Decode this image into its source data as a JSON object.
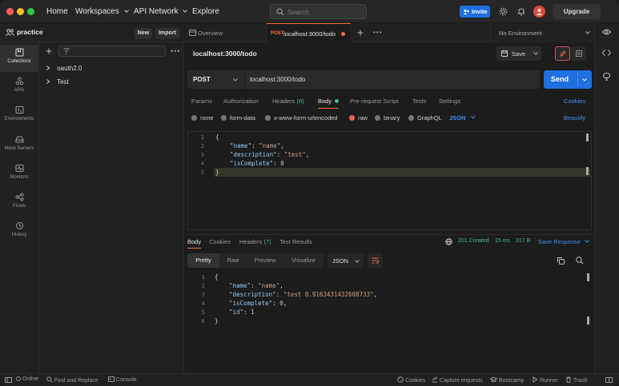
{
  "titlebar": {
    "nav": [
      "Home",
      "Workspaces",
      "API Network",
      "Explore"
    ],
    "search_placeholder": "Search",
    "invite_label": "Invite",
    "upgrade_label": "Upgrade"
  },
  "workspace": {
    "name": "practice",
    "new_label": "New",
    "import_label": "Import"
  },
  "rail": [
    {
      "label": "Collections",
      "icon": "collections-icon"
    },
    {
      "label": "APIs",
      "icon": "apis-icon"
    },
    {
      "label": "Environments",
      "icon": "environments-icon"
    },
    {
      "label": "Mock Servers",
      "icon": "mock-servers-icon"
    },
    {
      "label": "Monitors",
      "icon": "monitors-icon"
    },
    {
      "label": "Flows",
      "icon": "flows-icon"
    },
    {
      "label": "History",
      "icon": "history-icon"
    }
  ],
  "collections": [
    "oauth2.0",
    "Test"
  ],
  "tabs": {
    "overview": "Overview",
    "active_method": "POST",
    "active_title": "localhost:3000/todo",
    "environment": "No Environment"
  },
  "request": {
    "title": "localhost:3000/todo",
    "save_label": "Save",
    "method": "POST",
    "url": "localhost:3000/todo",
    "send_label": "Send",
    "subtabs": [
      "Params",
      "Authorization",
      "Headers",
      "Body",
      "Pre-request Script",
      "Tests",
      "Settings"
    ],
    "headers_count": "(8)",
    "cookies_label": "Cookies",
    "body_types": [
      "none",
      "form-data",
      "x-www-form-urlencoded",
      "raw",
      "binary",
      "GraphQL"
    ],
    "body_format": "JSON",
    "beautify_label": "Beautify",
    "line_numbers": [
      "1",
      "2",
      "3",
      "4",
      "5"
    ]
  },
  "request_body": {
    "open": "{",
    "k1": "\"name\"",
    "v1": "\"name\"",
    "k2": "\"description\"",
    "v2": "\"test\"",
    "k3": "\"isComplete\"",
    "v3": "0",
    "close": "}"
  },
  "response": {
    "tabs": [
      "Body",
      "Cookies",
      "Headers",
      "Test Results"
    ],
    "headers_count": "(7)",
    "status": "201 Created",
    "time": "15 ms",
    "size": "317 B",
    "save_response": "Save Response",
    "formats": [
      "Pretty",
      "Raw",
      "Preview",
      "Visualize"
    ],
    "format": "JSON",
    "line_numbers": [
      "1",
      "2",
      "3",
      "4",
      "5",
      "6"
    ],
    "status_color": "#49b889"
  },
  "response_body": {
    "open": "{",
    "k1": "\"name\"",
    "v1": "\"name\"",
    "k2": "\"description\"",
    "v2": "\"test 0.9163431432608733\"",
    "k3": "\"isComplete\"",
    "v3": "0",
    "k4": "\"id\"",
    "v4": "1",
    "close": "}"
  },
  "statusbar": {
    "online": "Online",
    "find_replace": "Find and Replace",
    "console": "Console",
    "cookies": "Cookies",
    "capture": "Capture requests",
    "bootcamp": "Bootcamp",
    "runner": "Runner",
    "trash": "Trash"
  },
  "colors": {
    "accent": "#ff6c37",
    "primary": "#1f6fe0"
  }
}
